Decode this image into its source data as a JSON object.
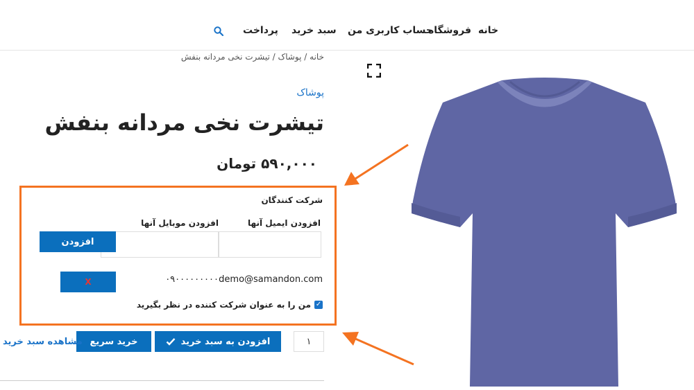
{
  "nav": {
    "items": [
      "خانه",
      "فروشگاه",
      "حساب کاربری من",
      "سبد خرید",
      "پرداخت"
    ]
  },
  "breadcrumb": "خانه / پوشاک / تیشرت نخی مردانه بنفش",
  "product": {
    "category": "پوشاک",
    "title": "تیشرت نخی مردانه بنفش",
    "price": "۵۹۰,۰۰۰ تومان"
  },
  "participants": {
    "label": "شرکت کنندگان",
    "email_label": "افزودن ایمیل آنها",
    "mobile_label": "افزودن موبایل آنها",
    "email_value": "",
    "mobile_value": "",
    "add_button": "افزودن",
    "rows": [
      {
        "email": "demo@samandon.com",
        "mobile": "۰۹۰۰۰۰۰۰۰۰۰",
        "remove": "X"
      }
    ],
    "self_checkbox_label": "من را به عنوان شرکت کننده در نظر بگیرید",
    "self_checked": true
  },
  "actions": {
    "quantity": "۱",
    "add_to_cart": "افزودن به سبد خرید",
    "buy_now": "خرید سریع",
    "view_cart": "مشاهده سبد خرید"
  },
  "colors": {
    "accent": "#0b6fbd",
    "link": "#1a73c8",
    "highlight_border": "#f47321",
    "shirt": "#5f66a4"
  },
  "icons": {
    "search": "search-icon",
    "fullscreen": "fullscreen-icon",
    "cart_check": "check-icon"
  }
}
